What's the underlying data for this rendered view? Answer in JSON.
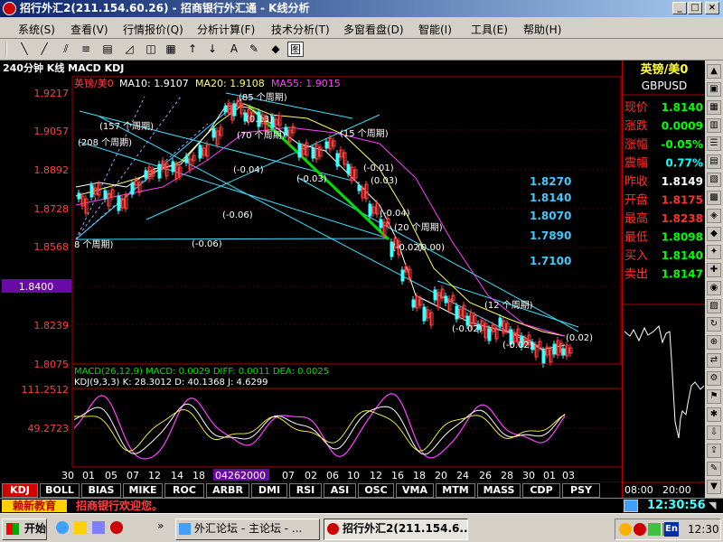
{
  "window": {
    "title": "招行外汇2(211.154.60.26) - 招商银行外汇通 - K线分析"
  },
  "menu": [
    "系统(S)",
    "查看(V)",
    "行情报价(Q)",
    "分析计算(F)",
    "技术分析(T)",
    "多窗看盘(D)",
    "智能(I)",
    "工具(E)",
    "帮助(H)"
  ],
  "chart": {
    "header": "240分钟 K线 MACD KDJ",
    "symbol_label": "英镑/美0",
    "ma10": "MA10: 1.9107",
    "ma20": "MA20: 1.9108",
    "ma55": "MA55: 1.9015",
    "price_ticks": [
      "1.9217",
      "1.9057",
      "1.8892",
      "1.8728",
      "1.8568",
      "1.8400",
      "1.8239",
      "1.8075"
    ],
    "price_selected": "1.8400",
    "levels": [
      "1.8270",
      "1.8140",
      "1.8070",
      "1.7890",
      "1.7100"
    ],
    "annotations": [
      "(157 个周期)",
      "(208 个周期)",
      "(85 个周期)",
      "(0.13)",
      "(70 个周期)",
      "(-0.04)",
      "(-0.03)",
      "(-0.06)",
      "(-0.06)",
      "(15 个周期)",
      "(-0.01)",
      "(0.03)",
      "(-0.04)",
      "(20 个周期)",
      "(-0.02)",
      "(0.00)",
      "8 个周期)",
      "(12 个周期)",
      "(0.02)",
      "(-0.02)"
    ],
    "macd_header": "MACD(26,12,9) MACD: 0.0029 DIFF: 0.0011 DEA: 0.0025",
    "kdj_header": "KDJ(9,3,3) K: 28.3012 D: 40.1368 J: 4.6299",
    "kdj_ticks": [
      "111.2512",
      "49.2723"
    ],
    "x_labels": [
      "30",
      "01",
      "05",
      "07",
      "12",
      "14",
      "18",
      "04262000",
      "07",
      "02",
      "06",
      "10",
      "12",
      "16",
      "18",
      "20",
      "24",
      "26",
      "28",
      "30",
      "01",
      "03"
    ],
    "x_selected": "04262000"
  },
  "quote": {
    "name": "英镑/美0",
    "code": "GBPUSD",
    "rows": [
      {
        "label": "现价",
        "value": "1.8140",
        "color": "#00ff00"
      },
      {
        "label": "涨跌",
        "value": "0.0009",
        "color": "#00ff00"
      },
      {
        "label": "涨幅",
        "value": "-0.05%",
        "color": "#00ff00"
      },
      {
        "label": "震幅",
        "value": "0.77%",
        "color": "#00ffff"
      },
      {
        "label": "昨收",
        "value": "1.8149",
        "color": "#ffffff"
      },
      {
        "label": "开盘",
        "value": "1.8175",
        "color": "#ff3030"
      },
      {
        "label": "最高",
        "value": "1.8238",
        "color": "#ff3030"
      },
      {
        "label": "最低",
        "value": "1.8098",
        "color": "#00ff00"
      },
      {
        "label": "买入",
        "value": "1.8140",
        "color": "#00ff00"
      },
      {
        "label": "卖出",
        "value": "1.8147",
        "color": "#00ff00"
      }
    ],
    "time_start": "08:00",
    "time_mid": "20:00",
    "clock": "12:30:56"
  },
  "tabs": [
    "KDJ",
    "BOLL",
    "BIAS",
    "MIKE",
    "ROC",
    "ARBR",
    "DMI",
    "RSI",
    "ASI",
    "OSC",
    "VMA",
    "MTM",
    "MASS",
    "CDP",
    "PSY"
  ],
  "status": {
    "logo": "赖新教育",
    "message": "招商银行欢迎您。"
  },
  "taskbar": {
    "start": "开始",
    "tasks": [
      "外汇论坛 - 主论坛 - ...",
      "招行外汇2(211.154.6..."
    ],
    "time": "12:30",
    "lang": "En"
  }
}
